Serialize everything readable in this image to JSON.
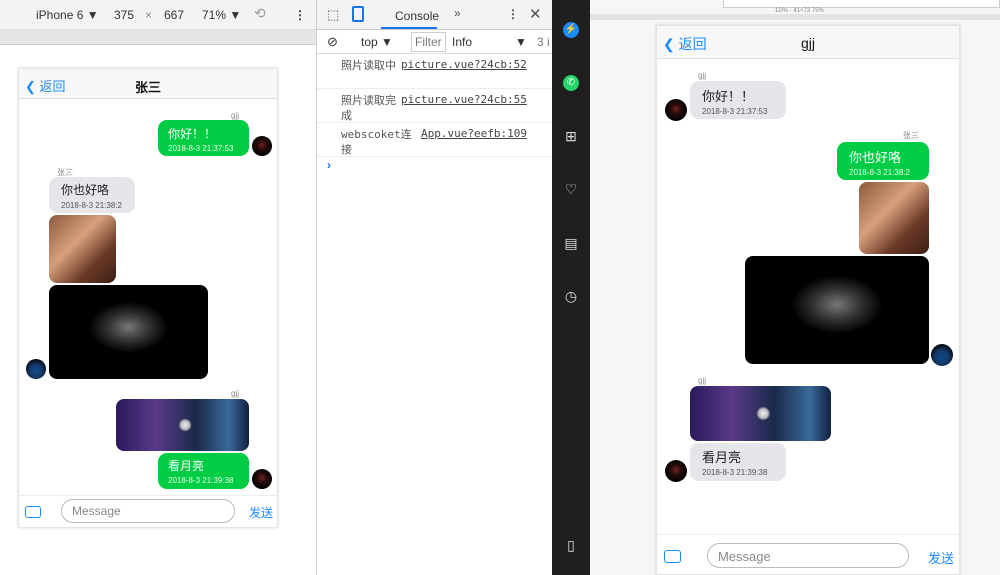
{
  "device_toolbar": {
    "device": "iPhone 6",
    "width": "375",
    "x": "×",
    "height": "667",
    "zoom": "71%"
  },
  "devtools": {
    "tab": "Console",
    "context": "top",
    "filter": "Filter",
    "level": "Info",
    "count": "3 i",
    "logs": [
      {
        "msg": "照片读取中",
        "src": "picture.vue?24cb:52"
      },
      {
        "msg": "照片读取完成",
        "src": "picture.vue?24cb:55"
      },
      {
        "msg": "webscoket连接",
        "src": "App.vue?eefb:109"
      }
    ],
    "prompt": "›"
  },
  "right_ruler": "1D% · 41×73 75%",
  "left_chat": {
    "back": "返回",
    "title": "张三",
    "messages": [
      {
        "sender": "gjj",
        "text": "你好！！",
        "time": "2018-8-3 21:37:53"
      },
      {
        "sender": "张三",
        "text": "你也好咯",
        "time": "2018-8-3 21:38:2"
      },
      {
        "sender": "gjj",
        "text": "看月亮",
        "time": "2018-8-3 21:39:38"
      }
    ],
    "placeholder": "Message",
    "send": "发送"
  },
  "right_chat": {
    "back": "返回",
    "title": "gjj",
    "messages": [
      {
        "sender": "gjj",
        "text": "你好！！",
        "time": "2018-8-3 21:37:53"
      },
      {
        "sender": "张三",
        "text": "你也好咯",
        "time": "2018-8-3 21:38:2"
      },
      {
        "sender": "gjj",
        "text": "看月亮",
        "time": "2018-8-3 21:39:38"
      }
    ],
    "placeholder": "Message",
    "send": "发送"
  }
}
